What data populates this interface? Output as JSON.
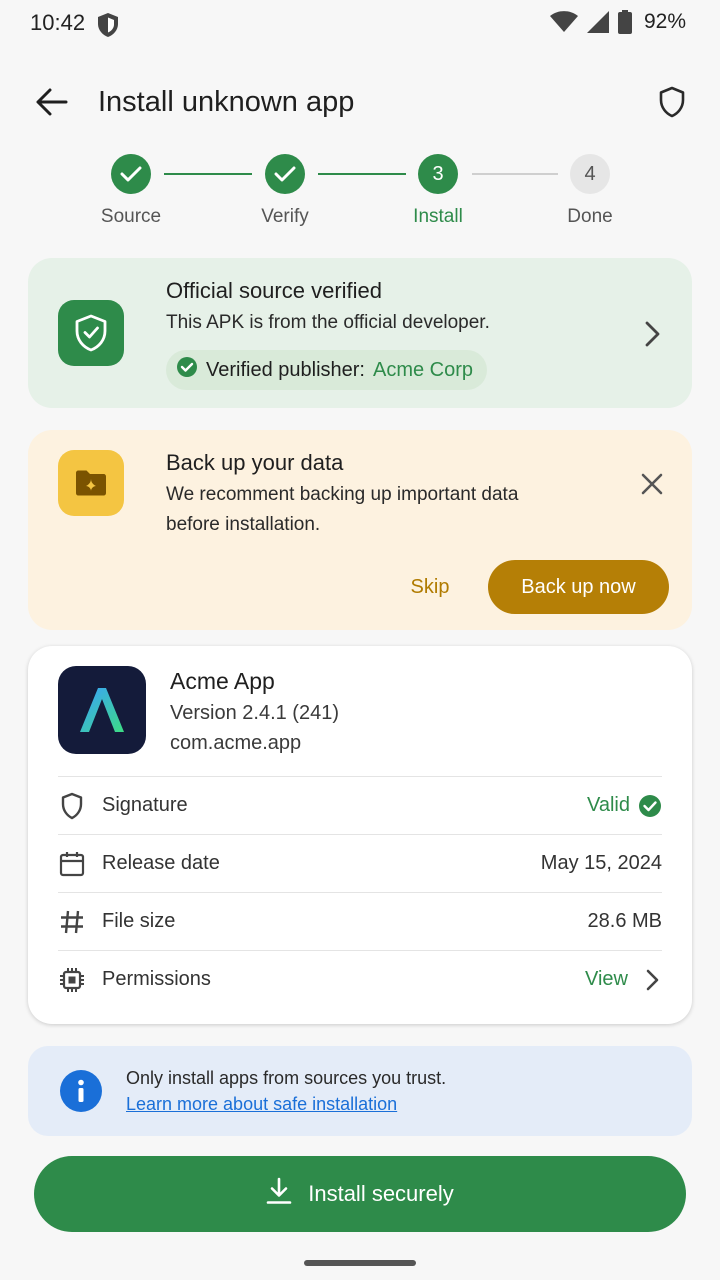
{
  "status_bar": {
    "time": "10:42",
    "battery": "92%"
  },
  "app_bar": {
    "title": "Install unknown app"
  },
  "stepper": {
    "steps": [
      {
        "number": "1",
        "label": "Source",
        "state": "done"
      },
      {
        "number": "2",
        "label": "Verify",
        "state": "done"
      },
      {
        "number": "3",
        "label": "Install",
        "state": "current"
      },
      {
        "number": "4",
        "label": "Done",
        "state": "pending"
      }
    ]
  },
  "verified_card": {
    "title": "Official source verified",
    "subtitle": "This APK is from the official developer.",
    "publisher_label": "Verified publisher:",
    "publisher_name": "Acme Corp"
  },
  "backup_card": {
    "title": "Back up your data",
    "description": "We recomment backing up important data before installation.",
    "skip_label": "Skip",
    "backup_label": "Back up now"
  },
  "app_info": {
    "name": "Acme App",
    "version": "Version 2.4.1 (241)",
    "package": "com.acme.app",
    "icon_letter": "A",
    "details": [
      {
        "icon": "shield-icon",
        "label": "Signature",
        "value": "Valid",
        "style": "green-check"
      },
      {
        "icon": "calendar-icon",
        "label": "Release date",
        "value": "May 15, 2024",
        "style": "plain"
      },
      {
        "icon": "hash-icon",
        "label": "File size",
        "value": "28.6 MB",
        "style": "plain"
      },
      {
        "icon": "chip-icon",
        "label": "Permissions",
        "value": "View",
        "style": "green-chevron"
      }
    ]
  },
  "info_banner": {
    "text": "Only install apps from sources you trust.",
    "link": "Learn more about safe installation"
  },
  "install_button": {
    "label": "Install securely"
  },
  "colors": {
    "primary_green": "#2e8b4a",
    "warning_amber": "#b57f06",
    "info_blue": "#1a6fd8",
    "background": "#f7f7f7"
  }
}
